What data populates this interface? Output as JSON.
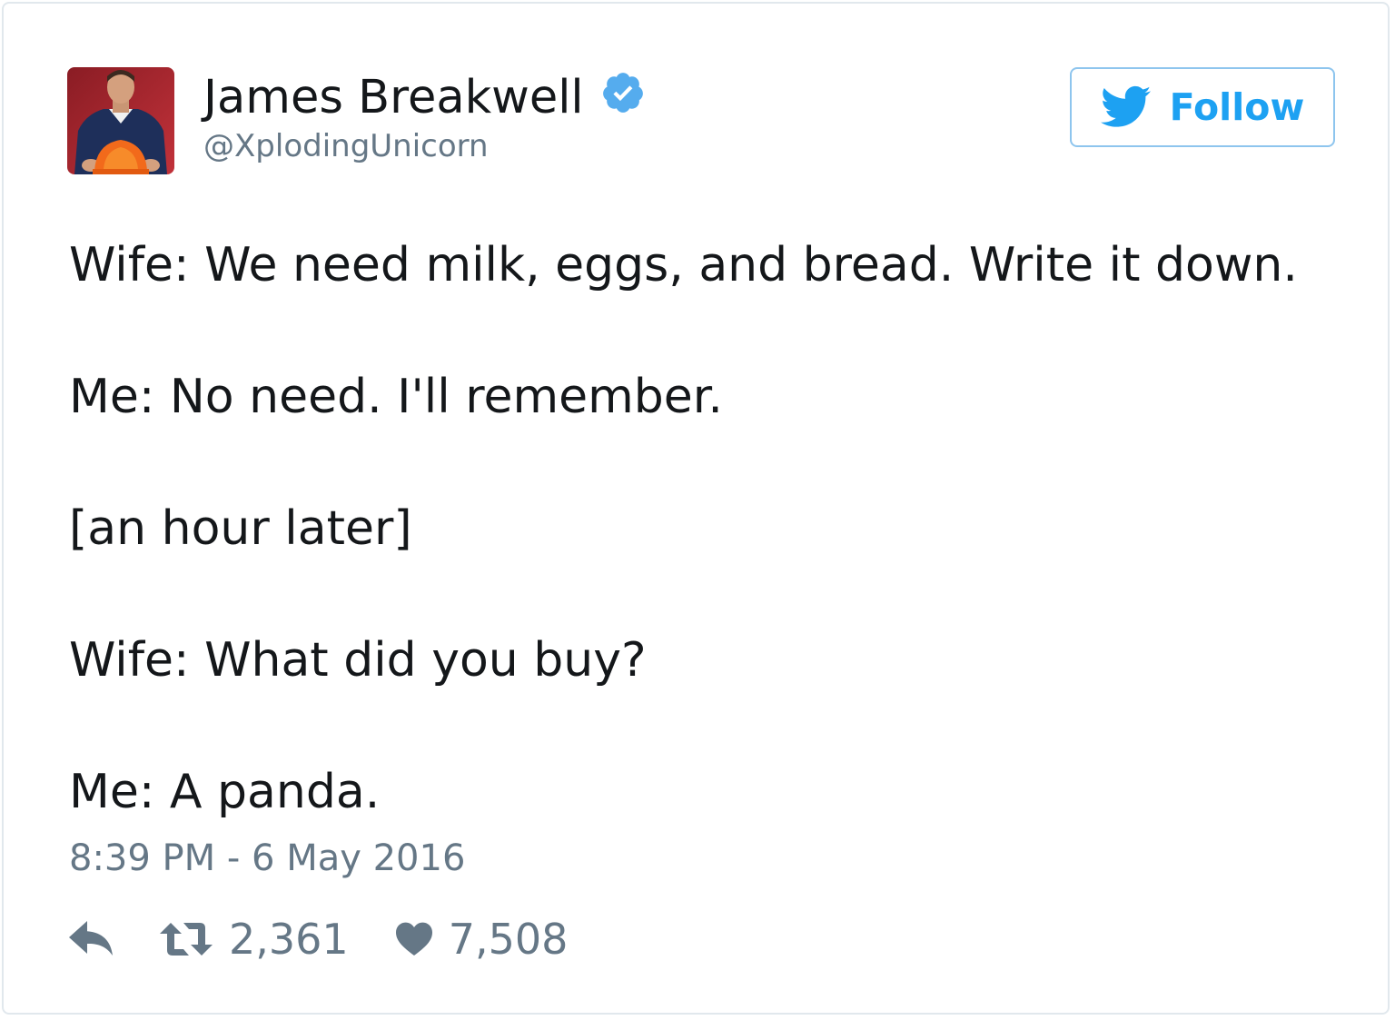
{
  "tweet": {
    "author": {
      "display_name": "James Breakwell",
      "handle": "@XplodingUnicorn",
      "verified": true,
      "avatar_icon": "user-avatar"
    },
    "follow_button": {
      "label": "Follow",
      "icon": "twitter-bird-icon"
    },
    "text_lines": [
      "Wife: We need milk, eggs, and bread. Write it down.",
      "Me: No need. I'll remember.",
      "[an hour later]",
      "Wife: What did you buy?",
      "Me: A panda."
    ],
    "timestamp": "8:39 PM - 6 May 2016",
    "actions": {
      "reply_icon": "reply-icon",
      "retweet_icon": "retweet-icon",
      "retweet_count": "2,361",
      "like_icon": "heart-icon",
      "like_count": "7,508"
    }
  },
  "colors": {
    "text_primary": "#14171a",
    "text_secondary": "#657786",
    "accent_blue": "#1da1f2",
    "verified_blue": "#55acee",
    "card_border": "#e1e8ed"
  }
}
